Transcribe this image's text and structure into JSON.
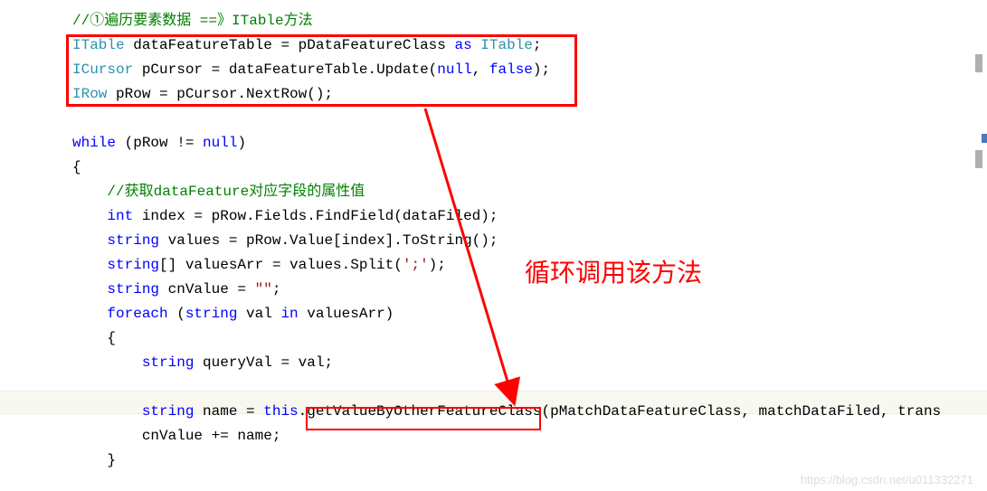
{
  "code": {
    "line1_comment": "//①遍历要素数据 ==》ITable方法",
    "line2": {
      "type1": "ITable",
      "rest": " dataFeatureTable = pDataFeatureClass ",
      "kw": "as",
      "type2": " ITable",
      "end": ";"
    },
    "line3": {
      "type1": "ICursor",
      "rest": " pCursor = dataFeatureTable.Update(",
      "kw1": "null",
      "mid": ", ",
      "kw2": "false",
      "end": ");"
    },
    "line4": {
      "type1": "IRow",
      "rest": " pRow = pCursor.NextRow();"
    },
    "line6": {
      "kw": "while",
      "rest": " (pRow != ",
      "kw2": "null",
      "end": ")"
    },
    "line7": "{",
    "line8_comment": "    //获取dataFeature对应字段的属性值",
    "line9": {
      "indent": "    ",
      "kw": "int",
      "rest": " index = pRow.Fields.FindField(dataFiled);"
    },
    "line10": {
      "indent": "    ",
      "kw": "string",
      "rest": " values = pRow.Value[index].ToString();"
    },
    "line11": {
      "indent": "    ",
      "kw": "string",
      "rest": "[] valuesArr = values.Split(",
      "str": "';'",
      "end": ");"
    },
    "line12": {
      "indent": "    ",
      "kw": "string",
      "rest": " cnValue = ",
      "str": "\"\"",
      "end": ";"
    },
    "line13": {
      "indent": "    ",
      "kw": "foreach",
      "rest": " (",
      "kw2": "string",
      "mid": " val ",
      "kw3": "in",
      "end": " valuesArr)"
    },
    "line14": "    {",
    "line15": {
      "indent": "        ",
      "kw": "string",
      "rest": " queryVal = val;"
    },
    "line17": {
      "indent": "        ",
      "kw": "string",
      "rest": " name = ",
      "kw2": "this",
      "method": ".getValueByOtherFeatureClass(pMatchDataFeatureClass, matchDataFiled, trans"
    },
    "line18": "        cnValue += name;",
    "line19": "    }"
  },
  "annotation": "循环调用该方法",
  "watermark": "https://blog.csdn.net/u011332271"
}
